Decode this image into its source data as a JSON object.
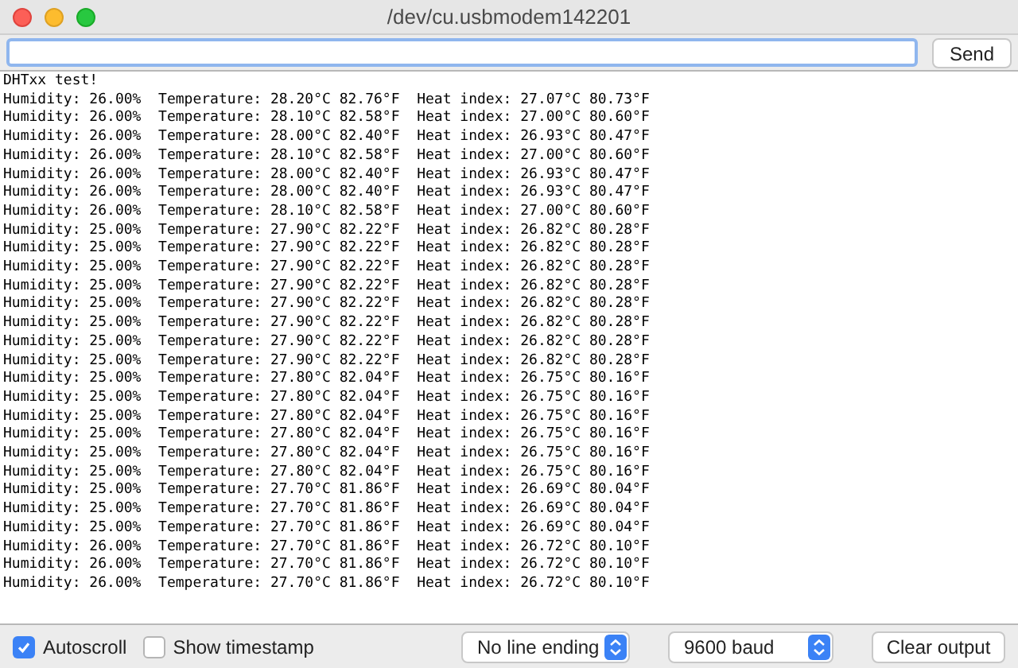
{
  "window": {
    "title": "/dev/cu.usbmodem142201"
  },
  "send_button": "Send",
  "output_lines": [
    "DHTxx test!",
    "Humidity: 26.00%  Temperature: 28.20°C 82.76°F  Heat index: 27.07°C 80.73°F",
    "Humidity: 26.00%  Temperature: 28.10°C 82.58°F  Heat index: 27.00°C 80.60°F",
    "Humidity: 26.00%  Temperature: 28.00°C 82.40°F  Heat index: 26.93°C 80.47°F",
    "Humidity: 26.00%  Temperature: 28.10°C 82.58°F  Heat index: 27.00°C 80.60°F",
    "Humidity: 26.00%  Temperature: 28.00°C 82.40°F  Heat index: 26.93°C 80.47°F",
    "Humidity: 26.00%  Temperature: 28.00°C 82.40°F  Heat index: 26.93°C 80.47°F",
    "Humidity: 26.00%  Temperature: 28.10°C 82.58°F  Heat index: 27.00°C 80.60°F",
    "Humidity: 25.00%  Temperature: 27.90°C 82.22°F  Heat index: 26.82°C 80.28°F",
    "Humidity: 25.00%  Temperature: 27.90°C 82.22°F  Heat index: 26.82°C 80.28°F",
    "Humidity: 25.00%  Temperature: 27.90°C 82.22°F  Heat index: 26.82°C 80.28°F",
    "Humidity: 25.00%  Temperature: 27.90°C 82.22°F  Heat index: 26.82°C 80.28°F",
    "Humidity: 25.00%  Temperature: 27.90°C 82.22°F  Heat index: 26.82°C 80.28°F",
    "Humidity: 25.00%  Temperature: 27.90°C 82.22°F  Heat index: 26.82°C 80.28°F",
    "Humidity: 25.00%  Temperature: 27.90°C 82.22°F  Heat index: 26.82°C 80.28°F",
    "Humidity: 25.00%  Temperature: 27.90°C 82.22°F  Heat index: 26.82°C 80.28°F",
    "Humidity: 25.00%  Temperature: 27.80°C 82.04°F  Heat index: 26.75°C 80.16°F",
    "Humidity: 25.00%  Temperature: 27.80°C 82.04°F  Heat index: 26.75°C 80.16°F",
    "Humidity: 25.00%  Temperature: 27.80°C 82.04°F  Heat index: 26.75°C 80.16°F",
    "Humidity: 25.00%  Temperature: 27.80°C 82.04°F  Heat index: 26.75°C 80.16°F",
    "Humidity: 25.00%  Temperature: 27.80°C 82.04°F  Heat index: 26.75°C 80.16°F",
    "Humidity: 25.00%  Temperature: 27.80°C 82.04°F  Heat index: 26.75°C 80.16°F",
    "Humidity: 25.00%  Temperature: 27.70°C 81.86°F  Heat index: 26.69°C 80.04°F",
    "Humidity: 25.00%  Temperature: 27.70°C 81.86°F  Heat index: 26.69°C 80.04°F",
    "Humidity: 25.00%  Temperature: 27.70°C 81.86°F  Heat index: 26.69°C 80.04°F",
    "Humidity: 26.00%  Temperature: 27.70°C 81.86°F  Heat index: 26.72°C 80.10°F",
    "Humidity: 26.00%  Temperature: 27.70°C 81.86°F  Heat index: 26.72°C 80.10°F",
    "Humidity: 26.00%  Temperature: 27.70°C 81.86°F  Heat index: 26.72°C 80.10°F"
  ],
  "options": [
    {
      "label": "Autoscroll",
      "checked": true
    },
    {
      "label": "Show timestamp",
      "checked": false
    }
  ],
  "selects": [
    {
      "value": "No line ending"
    },
    {
      "value": "9600 baud"
    }
  ],
  "clear_button": "Clear output"
}
